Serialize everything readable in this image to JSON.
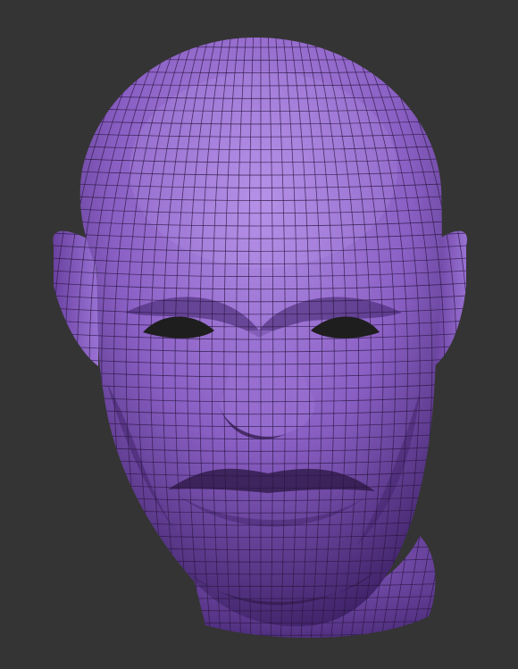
{
  "viewport": {
    "background": "#343434",
    "subject": "sculpted-head-mesh"
  },
  "mesh": {
    "base_color": "#8a5fc4",
    "highlight_color": "#b38ee6",
    "shadow_color": "#3d2166",
    "wire_color": "#2a1640",
    "wireframe": true
  }
}
